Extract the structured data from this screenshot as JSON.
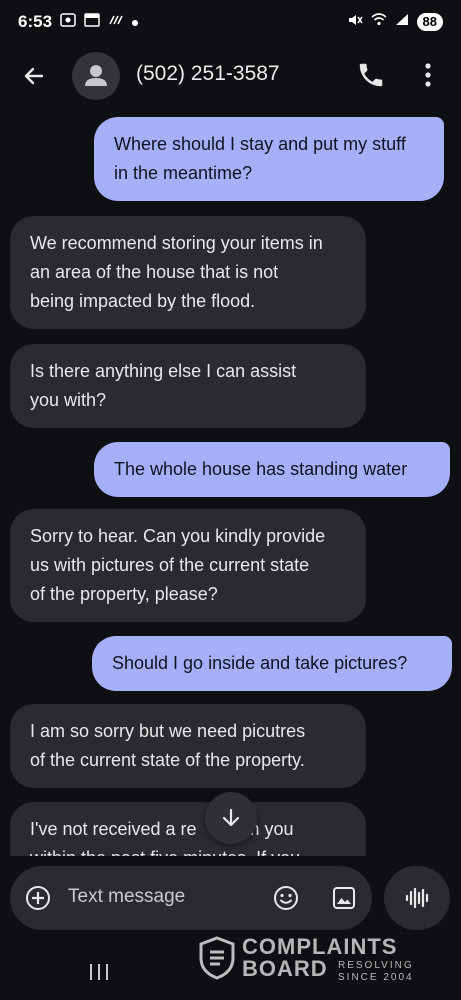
{
  "status_bar": {
    "time": "6:53",
    "battery": "88",
    "icons": [
      "screenshot-icon",
      "calendar-icon",
      "notification-icon",
      "dot-icon",
      "mute-icon",
      "wifi-icon",
      "signal-icon"
    ]
  },
  "app_bar": {
    "contact": "(502) 251-3587",
    "icons": [
      "back-arrow-icon",
      "person-avatar-icon",
      "phone-icon",
      "more-vert-icon"
    ]
  },
  "messages": [
    {
      "direction": "outgoing",
      "lines": [
        "Where should I stay and put my stuff",
        "in the meantime?"
      ]
    },
    {
      "direction": "incoming",
      "lines": [
        "We recommend storing your items in",
        "an area of the house that is not",
        "being impacted by the flood."
      ]
    },
    {
      "direction": "incoming",
      "lines": [
        "Is there anything else I can assist",
        "you with?"
      ]
    },
    {
      "direction": "outgoing",
      "lines": [
        "The whole house has standing water"
      ]
    },
    {
      "direction": "incoming",
      "lines": [
        "Sorry to hear. Can you kindly provide",
        "us with pictures of the current state",
        "of the property, please?"
      ]
    },
    {
      "direction": "outgoing",
      "lines": [
        "Should I go inside and take pictures?"
      ]
    },
    {
      "direction": "incoming",
      "lines": [
        "I am so sorry but we need picutres",
        "of the current state of the property."
      ]
    },
    {
      "direction": "incoming",
      "lines": [
        "I've not received a re",
        "om you",
        "within the past five minutes. If you"
      ]
    }
  ],
  "composer": {
    "placeholder": "Text message",
    "icons": [
      "add-circle-icon",
      "emoji-icon",
      "gallery-icon",
      "voice-waveform-icon",
      "scroll-down-arrow-icon"
    ]
  },
  "nav_bar": {
    "icons": [
      "recents-icon"
    ]
  },
  "watermark": {
    "line1": "COMPLAINTS",
    "line2": "BOARD",
    "tagline1": "RESOLVING",
    "tagline2": "SINCE 2004"
  },
  "colors": {
    "background": "#0e0f12",
    "outgoing_bubble": "#a6b0f8",
    "incoming_bubble": "#2a2b31",
    "surface": "#2a2b31"
  }
}
